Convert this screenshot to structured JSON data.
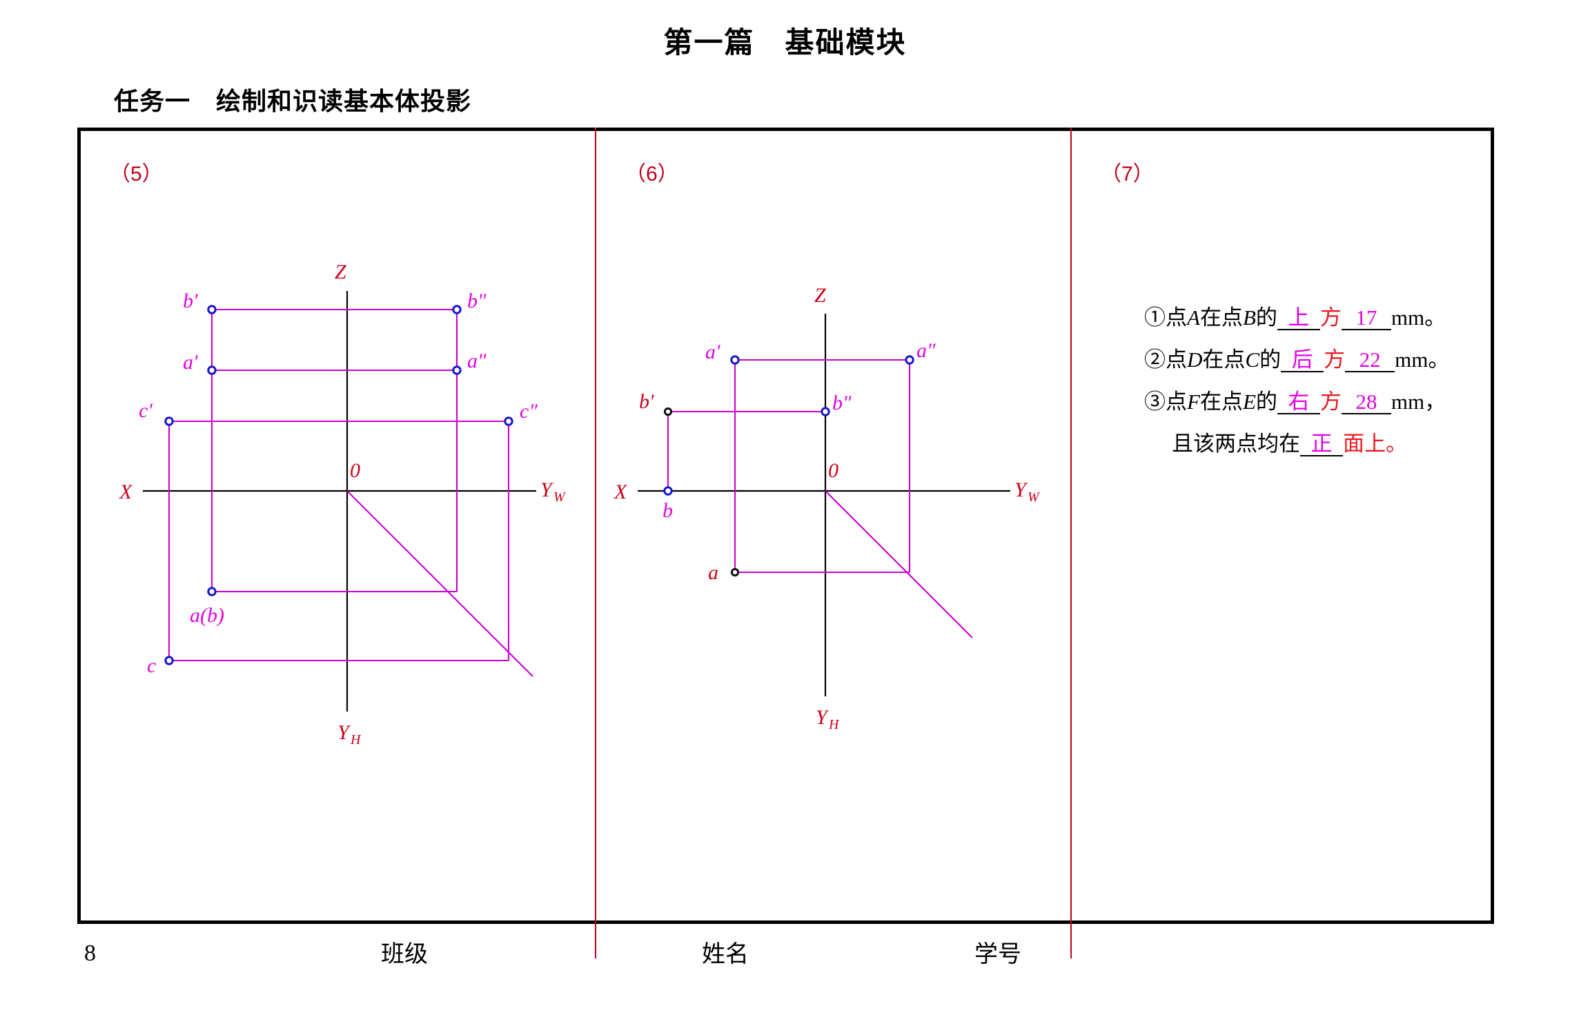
{
  "page": {
    "title": "第一篇　基础模块",
    "task_title": "任务一　绘制和识读基本体投影"
  },
  "panels": [
    {
      "label": "（5）"
    },
    {
      "label": "（6）"
    },
    {
      "label": "（7）"
    }
  ],
  "diagram5": {
    "axis_labels": {
      "x": "X",
      "z": "Z",
      "yw": "Y",
      "yw_sub": "W",
      "yh": "Y",
      "yh_sub": "H",
      "origin": "0"
    },
    "points": [
      {
        "id": "b-prime",
        "label": "b′"
      },
      {
        "id": "b-dprime",
        "label": "b″"
      },
      {
        "id": "a-prime",
        "label": "a′"
      },
      {
        "id": "a-dprime",
        "label": "a″"
      },
      {
        "id": "c-prime",
        "label": "c′"
      },
      {
        "id": "c-dprime",
        "label": "c″"
      },
      {
        "id": "ab",
        "label": "a(b)"
      },
      {
        "id": "c",
        "label": "c"
      }
    ]
  },
  "diagram6": {
    "axis_labels": {
      "x": "X",
      "z": "Z",
      "yw": "Y",
      "yw_sub": "W",
      "yh": "Y",
      "yh_sub": "H",
      "origin": "0"
    },
    "points": [
      {
        "id": "a-prime",
        "label": "a′"
      },
      {
        "id": "a-dprime",
        "label": "a″"
      },
      {
        "id": "b-prime",
        "label": "b′"
      },
      {
        "id": "b-dprime",
        "label": "b″"
      },
      {
        "id": "b",
        "label": "b"
      },
      {
        "id": "a",
        "label": "a"
      }
    ]
  },
  "answers": {
    "item1": {
      "num": "①",
      "pre": "点",
      "p1": "A",
      "mid": "在点",
      "p2": "B",
      "post": "的",
      "dir": "上",
      "fang": "方",
      "value": "17",
      "unit": "mm",
      "end": "。"
    },
    "item2": {
      "num": "②",
      "pre": "点",
      "p1": "D",
      "mid": "在点",
      "p2": "C",
      "post": "的",
      "dir": "后",
      "fang": "方",
      "value": "22",
      "unit": "mm",
      "end": "。"
    },
    "item3": {
      "num": "③",
      "pre": "点",
      "p1": "F",
      "mid": "在点",
      "p2": "E",
      "post": "的",
      "dir": "右",
      "fang": "方",
      "value": "28",
      "unit": "mm",
      "end": "，",
      "line2_pre": "且该两点均在",
      "line2_blank": "正",
      "line2_red": "面上",
      "line2_end": "。"
    }
  },
  "footer": {
    "page_number": "8",
    "class_label": "班级",
    "name_label": "姓名",
    "id_label": "学号"
  },
  "colors": {
    "frame": "#000000",
    "divider": "#c00018",
    "red_label": "#d10018",
    "magenta": "#e300e3",
    "point_marker": "#1515c8"
  }
}
